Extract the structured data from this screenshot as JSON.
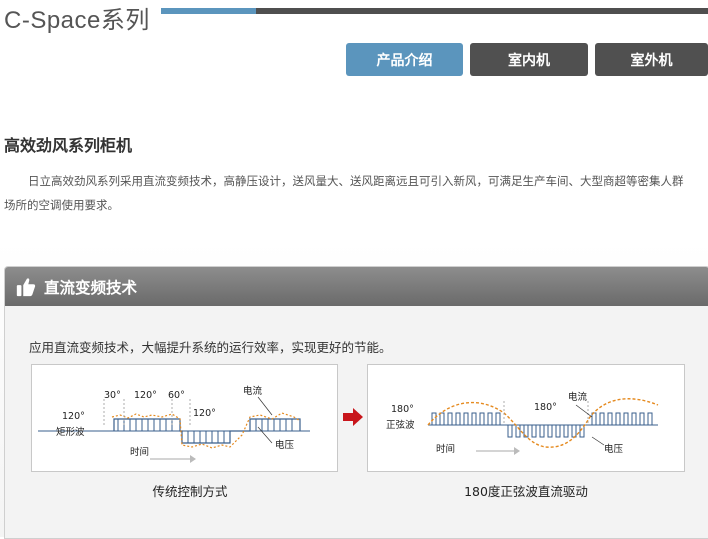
{
  "header": {
    "brand": "C-Space系列",
    "tabs": [
      {
        "label": "产品介绍",
        "active": true
      },
      {
        "label": "室内机",
        "active": false
      },
      {
        "label": "室外机",
        "active": false
      }
    ]
  },
  "intro": {
    "heading": "高效劲风系列柜机",
    "line1": "日立高效劲风系列采用直流变频技术，高静压设计，送风量大、送风距离远且可引入新风，可满足生产车间、大型商超等密集人群",
    "line2": "场所的空调使用要求。"
  },
  "feature": {
    "icon": "thumbs-up-icon",
    "title": "直流变频技术",
    "text": "应用直流变频技术，大幅提升系统的运行效率，实现更好的节能。",
    "left_diagram": {
      "wave_label_1": "120°",
      "wave_label_2": "矩形波",
      "seg1": "30°",
      "seg2": "120°",
      "seg3": "60°",
      "seg4": "120°",
      "current": "电流",
      "voltage": "电压",
      "time": "时间",
      "caption": "传统控制方式"
    },
    "right_diagram": {
      "wave_label_1": "180°",
      "wave_label_2": "正弦波",
      "seg": "180°",
      "current": "电流",
      "voltage": "电压",
      "time": "时间",
      "caption": "180度正弦波直流驱动"
    }
  },
  "colors": {
    "accent": "#5b95bd",
    "tab_dark": "#505050",
    "bar": "#777777",
    "wave_blue": "#3a5f8c",
    "wave_orange": "#e58a1f",
    "arrow_red": "#c8151b"
  }
}
